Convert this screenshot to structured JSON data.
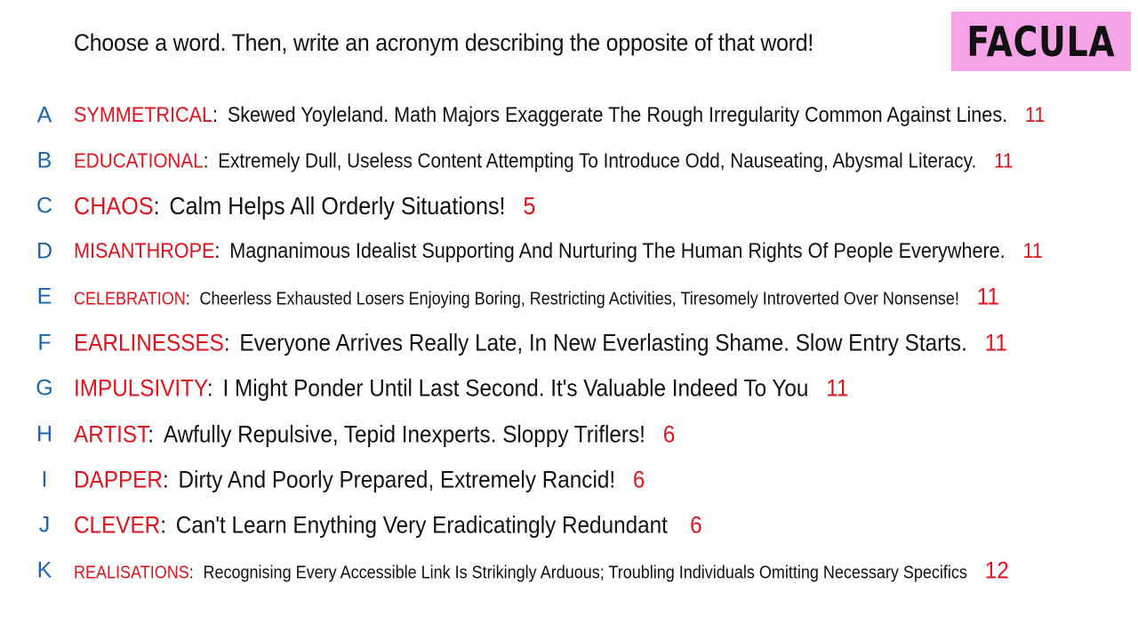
{
  "instructions": "Choose a word. Then, write an acronym describing the opposite of that word!",
  "logo": "FACULA",
  "colors": {
    "word": "#e0131c",
    "count": "#e0131c",
    "letter": "#1a63ad",
    "logo_bg": "#f6a3e8",
    "text": "#111111"
  },
  "rows": [
    {
      "letter": "A",
      "word": "SYMMETRICAL",
      "acronym": "Skewed Yoyleland. Math Majors Exaggerate The Rough Irregularity Common Against Lines.",
      "count": "11"
    },
    {
      "letter": "B",
      "word": "EDUCATIONAL",
      "acronym": "Extremely Dull, Useless Content Attempting To Introduce Odd, Nauseating, Abysmal Literacy.",
      "count": "11"
    },
    {
      "letter": "C",
      "word": "CHAOS",
      "acronym": "Calm Helps All Orderly Situations!",
      "count": "5"
    },
    {
      "letter": "D",
      "word": "MISANTHROPE",
      "acronym": "Magnanimous Idealist Supporting And Nurturing The Human Rights Of People Everywhere.",
      "count": "11"
    },
    {
      "letter": "E",
      "word": "CELEBRATION",
      "acronym": "Cheerless Exhausted Losers Enjoying Boring, Restricting Activities, Tiresomely Introverted Over Nonsense!",
      "count": "11"
    },
    {
      "letter": "F",
      "word": "EARLINESSES",
      "acronym": "Everyone Arrives Really Late, In New Everlasting Shame. Slow Entry Starts.",
      "count": "11"
    },
    {
      "letter": "G",
      "word": "IMPULSIVITY",
      "acronym": "I Might Ponder Until Last Second. It's Valuable Indeed To You",
      "count": "11"
    },
    {
      "letter": "H",
      "word": "ARTIST",
      "acronym": "Awfully Repulsive, Tepid Inexperts. Sloppy Triflers!",
      "count": "6"
    },
    {
      "letter": "I",
      "word": "DAPPER",
      "acronym": "Dirty And Poorly Prepared, Extremely Rancid!",
      "count": "6"
    },
    {
      "letter": "J",
      "word": "CLEVER",
      "acronym": "Can't Learn Enything Very Eradicatingly Redundant",
      "count": "6"
    },
    {
      "letter": "K",
      "word": "REALISATIONS",
      "acronym": "Recognising Every Accessible Link Is Strikingly Arduous; Troubling Individuals Omitting Necessary Specifics",
      "count": "12"
    }
  ]
}
